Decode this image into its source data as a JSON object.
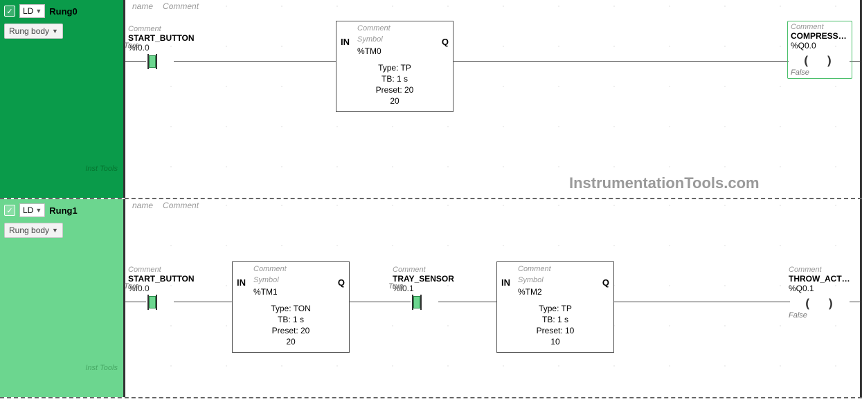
{
  "ui": {
    "ld_label": "LD",
    "rung_body_label": "Rung body",
    "header_name": "name",
    "header_comment": "Comment",
    "side_watermark": "Inst Tools",
    "main_watermark": "InstrumentationTools.com",
    "comment_placeholder": "Comment",
    "symbol_placeholder": "Symbol"
  },
  "rungs": [
    {
      "name": "Rung0",
      "contacts": [
        {
          "name": "START_BUTTON",
          "addr": "%I0.0",
          "state": "True"
        }
      ],
      "blocks": [
        {
          "addr": "%TM0",
          "type": "Type: TP",
          "tb": "TB: 1 s",
          "preset": "Preset: 20",
          "val": "20"
        }
      ],
      "coil": {
        "name": "COMPRESSION",
        "addr": "%Q0.0",
        "state": "False",
        "active": true
      }
    },
    {
      "name": "Rung1",
      "contacts": [
        {
          "name": "START_BUTTON",
          "addr": "%I0.0",
          "state": "True"
        },
        {
          "name": "TRAY_SENSOR",
          "addr": "%I0.1",
          "state": "True"
        }
      ],
      "blocks": [
        {
          "addr": "%TM1",
          "type": "Type: TON",
          "tb": "TB: 1 s",
          "preset": "Preset: 20",
          "val": "20"
        },
        {
          "addr": "%TM2",
          "type": "Type: TP",
          "tb": "TB: 1 s",
          "preset": "Preset: 10",
          "val": "10"
        }
      ],
      "coil": {
        "name": "THROW_ACTU...",
        "addr": "%Q0.1",
        "state": "False",
        "active": false
      }
    }
  ]
}
